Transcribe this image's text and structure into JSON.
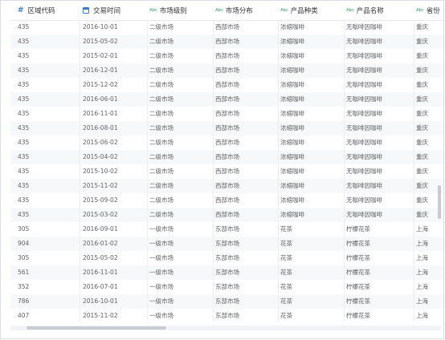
{
  "table": {
    "columns": [
      {
        "label": "区域代码",
        "type_icon": "#"
      },
      {
        "label": "交易时间",
        "type_icon": "calendar"
      },
      {
        "label": "市场级别",
        "type_icon": "Abc"
      },
      {
        "label": "市场分布",
        "type_icon": "Abc"
      },
      {
        "label": "产品种类",
        "type_icon": "Abc"
      },
      {
        "label": "产品名称",
        "type_icon": "Abc"
      },
      {
        "label": "省份",
        "type_icon": "Abc"
      }
    ],
    "rows": [
      [
        "435",
        "2016-10-01",
        "二级市场",
        "西部市场",
        "浓缩咖啡",
        "无咖啡因咖啡",
        "重庆"
      ],
      [
        "435",
        "2015-05-02",
        "二级市场",
        "西部市场",
        "浓缩咖啡",
        "无咖啡因咖啡",
        "重庆"
      ],
      [
        "435",
        "2015-02-01",
        "二级市场",
        "西部市场",
        "浓缩咖啡",
        "无咖啡因咖啡",
        "重庆"
      ],
      [
        "435",
        "2016-12-01",
        "二级市场",
        "西部市场",
        "浓缩咖啡",
        "无咖啡因咖啡",
        "重庆"
      ],
      [
        "435",
        "2015-12-02",
        "二级市场",
        "西部市场",
        "浓缩咖啡",
        "无咖啡因咖啡",
        "重庆"
      ],
      [
        "435",
        "2016-06-01",
        "二级市场",
        "西部市场",
        "浓缩咖啡",
        "无咖啡因咖啡",
        "重庆"
      ],
      [
        "435",
        "2016-11-01",
        "二级市场",
        "西部市场",
        "浓缩咖啡",
        "无咖啡因咖啡",
        "重庆"
      ],
      [
        "435",
        "2016-08-01",
        "二级市场",
        "西部市场",
        "浓缩咖啡",
        "无咖啡因咖啡",
        "重庆"
      ],
      [
        "435",
        "2015-06-02",
        "二级市场",
        "西部市场",
        "浓缩咖啡",
        "无咖啡因咖啡",
        "重庆"
      ],
      [
        "435",
        "2015-04-02",
        "二级市场",
        "西部市场",
        "浓缩咖啡",
        "无咖啡因咖啡",
        "重庆"
      ],
      [
        "435",
        "2015-10-02",
        "二级市场",
        "西部市场",
        "浓缩咖啡",
        "无咖啡因咖啡",
        "重庆"
      ],
      [
        "435",
        "2015-11-02",
        "二级市场",
        "西部市场",
        "浓缩咖啡",
        "无咖啡因咖啡",
        "重庆"
      ],
      [
        "435",
        "2015-09-02",
        "二级市场",
        "西部市场",
        "浓缩咖啡",
        "无咖啡因咖啡",
        "重庆"
      ],
      [
        "435",
        "2015-03-02",
        "二级市场",
        "西部市场",
        "浓缩咖啡",
        "无咖啡因咖啡",
        "重庆"
      ],
      [
        "305",
        "2016-09-01",
        "一级市场",
        "东部市场",
        "花茶",
        "柠檬花茶",
        "上海"
      ],
      [
        "904",
        "2016-01-02",
        "一级市场",
        "东部市场",
        "花茶",
        "柠檬花茶",
        "上海"
      ],
      [
        "305",
        "2015-05-02",
        "一级市场",
        "东部市场",
        "花茶",
        "柠檬花茶",
        "上海"
      ],
      [
        "561",
        "2016-11-01",
        "一级市场",
        "东部市场",
        "花茶",
        "柠檬花茶",
        "上海"
      ],
      [
        "352",
        "2016-07-01",
        "一级市场",
        "东部市场",
        "花茶",
        "柠檬花茶",
        "上海"
      ],
      [
        "786",
        "2016-10-01",
        "一级市场",
        "东部市场",
        "花茶",
        "柠檬花茶",
        "上海"
      ],
      [
        "407",
        "2015-11-02",
        "一级市场",
        "东部市场",
        "花茶",
        "柠檬花茶",
        "上海"
      ]
    ]
  },
  "colors": {
    "number_type_icon": "#3a7bd5",
    "text_type_icon": "#3aa56b",
    "row_alt_bg": "#f7f8fa",
    "cell_text": "#606266"
  }
}
